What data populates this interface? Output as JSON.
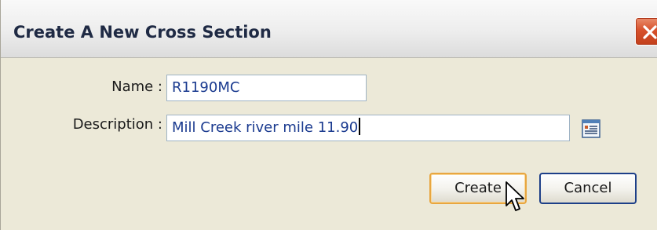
{
  "dialog": {
    "title": "Create A New Cross Section"
  },
  "form": {
    "name_label": "Name :",
    "name_value": "R1190MC",
    "description_label": "Description :",
    "description_value": "Mill Creek river mile 11.90"
  },
  "buttons": {
    "create_label": "Create",
    "cancel_label": "Cancel"
  },
  "icons": {
    "close": "close-icon",
    "description_editor": "text-editor-icon",
    "pointer": "mouse-pointer-icon"
  },
  "colors": {
    "close_button": "#d7512c",
    "field_text": "#1a3a8f",
    "default_button_border": "#e8a640",
    "cancel_button_border": "#1d3f88"
  }
}
